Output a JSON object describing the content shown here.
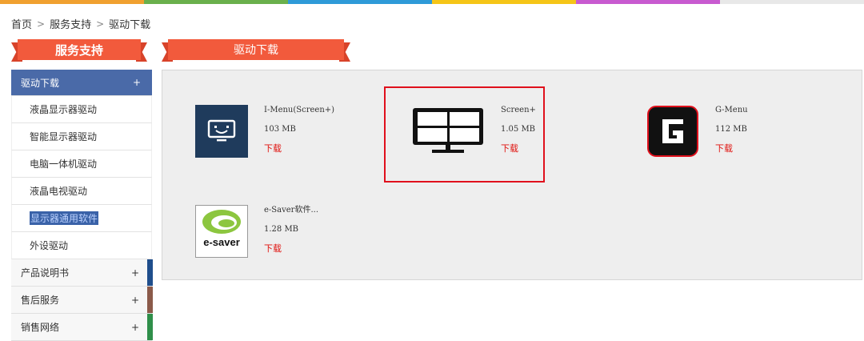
{
  "top_colors": [
    "#f0a030",
    "#6ab04c",
    "#2e9ad8",
    "#f5c518",
    "#c85bd0",
    "#e8e8e8"
  ],
  "breadcrumb": {
    "home": "首页",
    "sep1": ">",
    "service": "服务支持",
    "sep2": ">",
    "current": "驱动下载"
  },
  "left_ribbon": {
    "label": "服务支持"
  },
  "right_ribbon": {
    "label": "驱动下载"
  },
  "sidebar": {
    "head": {
      "label": "驱动下载",
      "toggle": "+"
    },
    "items": [
      {
        "label": "液晶显示器驱动"
      },
      {
        "label": "智能显示器驱动"
      },
      {
        "label": "电脑一体机驱动"
      },
      {
        "label": "液晶电视驱动"
      },
      {
        "label": "显示器通用软件"
      },
      {
        "label": "外设驱动"
      }
    ],
    "groups": [
      {
        "label": "产品说明书",
        "toggle": "+",
        "color": "#1f4e8c"
      },
      {
        "label": "售后服务",
        "toggle": "+",
        "color": "#8b5a4a"
      },
      {
        "label": "销售网络",
        "toggle": "+",
        "color": "#2f8f4a"
      }
    ]
  },
  "downloads": [
    {
      "name": "I-Menu(Screen+)",
      "size": "103 MB",
      "link": "下载",
      "icon": "monitor-smile-icon"
    },
    {
      "name": "Screen+",
      "size": "1.05 MB",
      "link": "下载",
      "icon": "split-screen-monitor-icon"
    },
    {
      "name": "G-Menu",
      "size": "112 MB",
      "link": "下载",
      "icon": "g-menu-logo-icon"
    },
    {
      "name": "e-Saver软件...",
      "size": "1.28 MB",
      "link": "下载",
      "icon": "e-saver-logo-icon"
    }
  ],
  "esaver_logo_text": "e-saver"
}
